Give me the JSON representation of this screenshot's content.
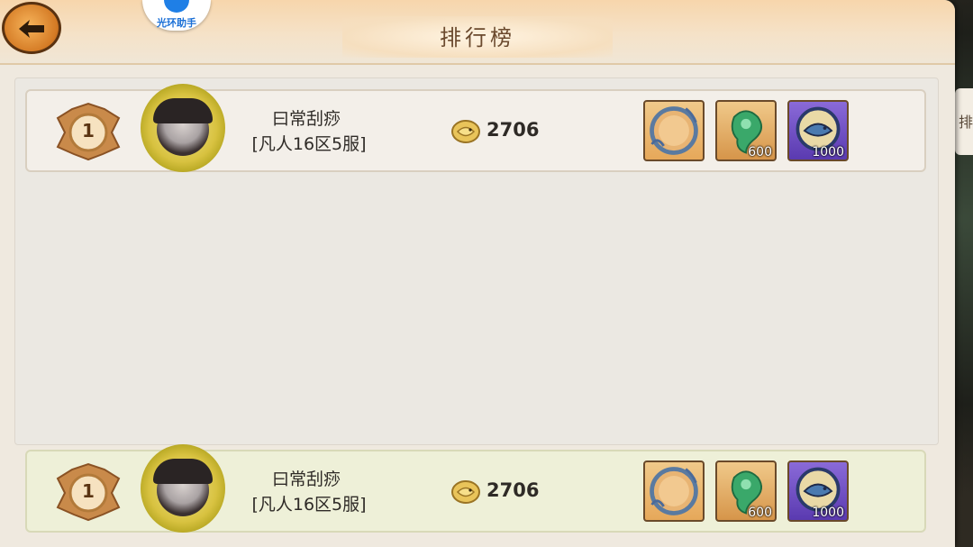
{
  "window": {
    "title": "排行榜",
    "helper_label": "光环助手",
    "side_tab_label": "排"
  },
  "ranking": {
    "rows": [
      {
        "rank": "1",
        "player_name": "曰常刮痧",
        "player_server": "[凡人16区5服]",
        "score": "2706",
        "rewards": [
          {
            "icon": "avatar-frame-icon",
            "count": ""
          },
          {
            "icon": "jade-icon",
            "count": "600"
          },
          {
            "icon": "fish-coin-icon",
            "count": "1000"
          }
        ]
      }
    ]
  },
  "self_row": {
    "rank": "1",
    "player_name": "曰常刮痧",
    "player_server": "[凡人16区5服]",
    "score": "2706",
    "rewards": [
      {
        "icon": "avatar-frame-icon",
        "count": ""
      },
      {
        "icon": "jade-icon",
        "count": "600"
      },
      {
        "icon": "fish-coin-icon",
        "count": "1000"
      }
    ]
  },
  "colors": {
    "panel_bg": "#efe9df",
    "header_bg": "#f7d6ac",
    "self_row_bg": "#eef0d8",
    "note_red": "#c23a1e"
  }
}
